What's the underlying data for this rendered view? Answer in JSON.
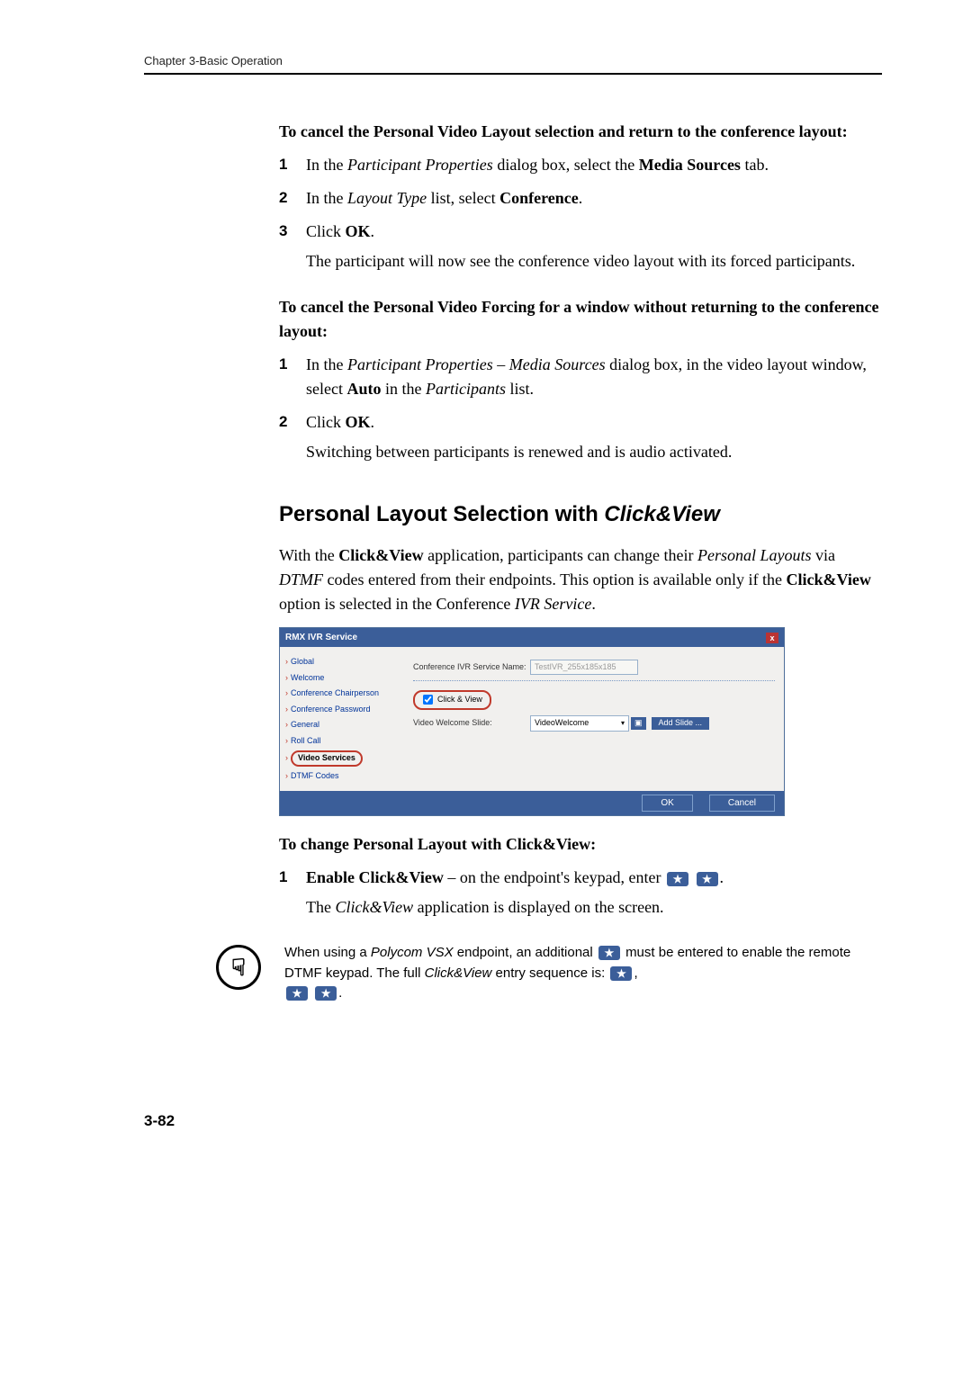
{
  "header": {
    "chapter": "Chapter 3-Basic Operation"
  },
  "sec1": {
    "heading": "To cancel the Personal Video Layout selection and return to the conference layout:",
    "s1_a": "In the ",
    "s1_b": "Participant Properties",
    "s1_c": " dialog box, select the ",
    "s1_d": "Media Sources",
    "s1_e": " tab.",
    "s2_a": "In the ",
    "s2_b": "Layout Type",
    "s2_c": " list, select ",
    "s2_d": "Conference",
    "s2_e": ".",
    "s3_a": "Click ",
    "s3_b": "OK",
    "s3_c": ".",
    "s3_p2": "The participant will now see the conference video layout with its forced participants."
  },
  "sec2": {
    "heading": "To cancel the Personal Video Forcing for a window without returning to the conference layout:",
    "s1_a": "In the ",
    "s1_b": "Participant Properties – Media Sources",
    "s1_c": " dialog box, in the video layout window, select ",
    "s1_d": "Auto",
    "s1_e": " in the ",
    "s1_f": "Participants",
    "s1_g": " list.",
    "s2_a": "Click ",
    "s2_b": "OK",
    "s2_c": ".",
    "s2_p2": "Switching between participants is renewed and is audio activated."
  },
  "sec3": {
    "title_a": "Personal Layout Selection with ",
    "title_b": "Click&View",
    "p1_a": "With the ",
    "p1_b": "Click&View",
    "p1_c": " application, participants can change their ",
    "p1_d": "Personal Layouts",
    "p1_e": " via ",
    "p1_f": "DTMF",
    "p1_g": " codes entered from their endpoints. This option is available only if the ",
    "p1_h": "Click&View",
    "p1_i": " option is selected in the Conference ",
    "p1_j": "IVR Service",
    "p1_k": "."
  },
  "dialog": {
    "title": "RMX IVR Service",
    "nav": {
      "items": [
        "Global",
        "Welcome",
        "Conference Chairperson",
        "Conference Password",
        "General",
        "Roll Call",
        "Video Services",
        "DTMF Codes"
      ]
    },
    "field1_label": "Conference IVR Service Name:",
    "field1_value": "TestIVR_255x185x185",
    "clickview_label": "Click & View",
    "field2_label": "Video Welcome Slide:",
    "field2_value": "VideoWelcome",
    "preview_icon": "▣",
    "add_slide": "Add Slide ...",
    "ok": "OK",
    "cancel": "Cancel",
    "close": "x"
  },
  "sec4": {
    "heading": "To change Personal Layout with Click&View:",
    "s1_a": "Enable Click&View",
    "s1_b": " – on the endpoint's keypad, enter ",
    "s1_p2_a": "The ",
    "s1_p2_b": "Click&View",
    "s1_p2_c": " application is displayed on the screen."
  },
  "note": {
    "a": "When using a ",
    "b": "Polycom VSX",
    "c": " endpoint, an additional ",
    "d": " must be entered to enable the remote DTMF keypad. The full ",
    "e": "Click&View",
    "f": " entry sequence is: ",
    "star": "★",
    "comma": ",",
    "period": "."
  },
  "pagenum": "3-82"
}
